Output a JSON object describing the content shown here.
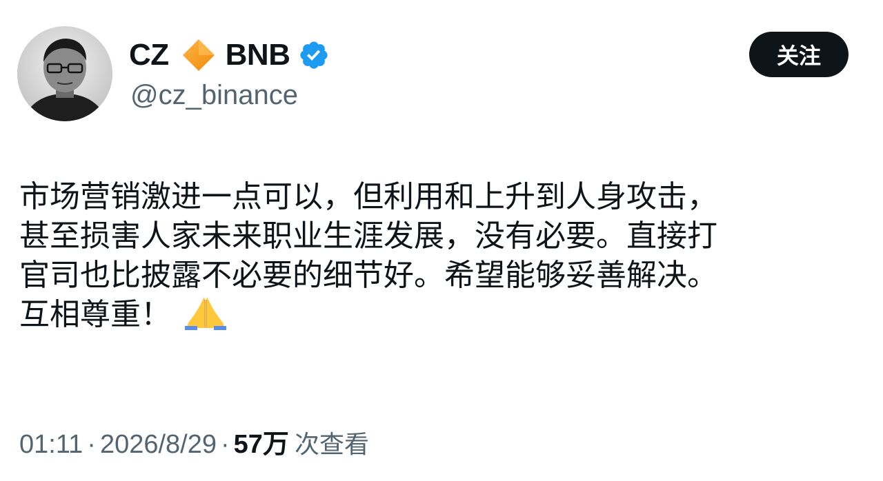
{
  "author": {
    "name_left": "CZ",
    "name_right": "BNB",
    "handle": "@cz_binance",
    "avatar_icon": "profile-photo",
    "diamond_icon": "orange-diamond-icon",
    "verified_icon": "verified-badge-icon",
    "diamond_color": "#F7931A",
    "verified_color": "#1D9BF0"
  },
  "follow_button": {
    "label": "关注"
  },
  "tweet": {
    "lines": [
      "市场营销激进一点可以，但利用和上升到人身攻击，",
      "甚至损害人家未来职业生涯发展，没有必要。直接打",
      "官司也比披露不必要的细节好。希望能够妥善解决。",
      "互相尊重！"
    ],
    "emoji": "folded-hands-emoji"
  },
  "meta": {
    "time": "01:11",
    "separator": "·",
    "date": "2026/8/29",
    "views_count": "57万",
    "views_label": "次查看"
  }
}
